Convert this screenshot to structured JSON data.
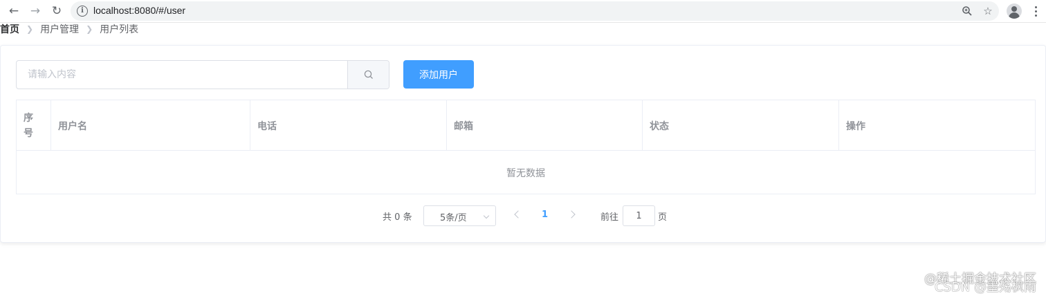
{
  "browser": {
    "url": "localhost:8080/#/user",
    "icons": [
      "back-icon",
      "forward-icon",
      "reload-icon",
      "info-icon",
      "zoom-icon",
      "star-icon",
      "profile-icon",
      "menu-icon"
    ]
  },
  "breadcrumb": {
    "home": "首页",
    "section": "用户管理",
    "page": "用户列表"
  },
  "toolbar": {
    "search_placeholder": "请输入内容",
    "add_label": "添加用户",
    "accent_color": "#409eff"
  },
  "table": {
    "columns": [
      "序号",
      "用户名",
      "电话",
      "邮箱",
      "状态",
      "操作"
    ],
    "index_header_lines": [
      "序",
      "号"
    ],
    "rows": [],
    "empty_text": "暂无数据"
  },
  "pagination": {
    "total_prefix": "共",
    "total": "0",
    "total_suffix": "条",
    "page_size": "5条/页",
    "current_page": "1",
    "goto_label": "前往",
    "goto_value": "1",
    "goto_suffix": "页"
  },
  "watermark": {
    "line1": "@稀土掘金技术社区",
    "line2": "CSDN @墨殇枫雨"
  }
}
